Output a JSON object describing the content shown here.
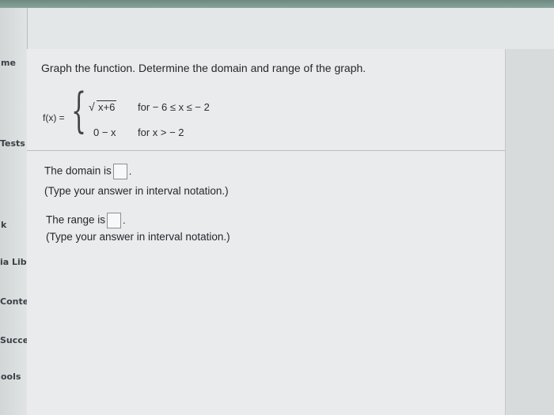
{
  "sidebar": {
    "items": [
      "me",
      "Tests",
      "k",
      "ia Lib",
      "Conter",
      "Succes",
      "ools"
    ]
  },
  "question": {
    "prompt": "Graph the function. Determine the domain and range of the graph.",
    "function_label": "f(x) =",
    "piece1_expr": "x+6",
    "piece1_cond": "for  − 6 ≤ x ≤ − 2",
    "piece2_expr": "0 − x",
    "piece2_cond": "for  x > − 2"
  },
  "answers": {
    "domain_label": "The domain is",
    "domain_hint": "(Type your answer in interval notation.)",
    "range_label": "The range is",
    "range_hint": "(Type your answer in interval notation.)"
  },
  "colors": {
    "topbar": "#6b8a80",
    "panel": "#e9ebec"
  }
}
